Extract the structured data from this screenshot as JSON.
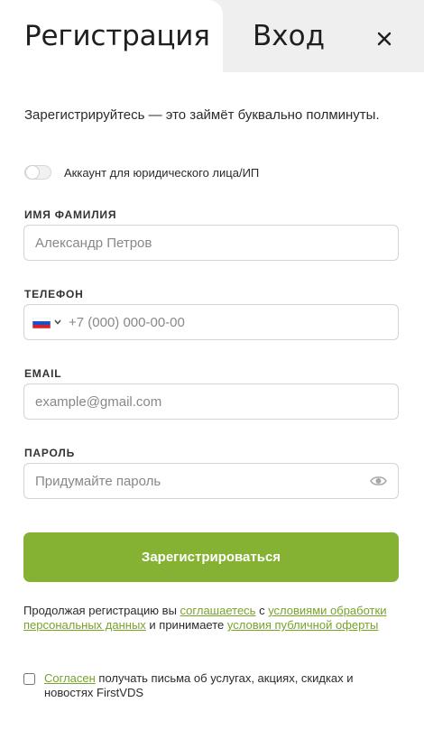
{
  "tabs": {
    "register": "Регистрация",
    "login": "Вход"
  },
  "intro": "Зарегистрируйтесь — это займёт буквально полминуты.",
  "legal_toggle": {
    "label": "Аккаунт для юридического лица/ИП",
    "on": false
  },
  "fields": {
    "name": {
      "label": "ИМЯ ФАМИЛИЯ",
      "placeholder": "Александр Петров",
      "value": ""
    },
    "phone": {
      "label": "ТЕЛЕФОН",
      "placeholder": "+7 (000) 000-00-00",
      "value": "",
      "country": "RU"
    },
    "email": {
      "label": "EMAIL",
      "placeholder": "example@gmail.com",
      "value": ""
    },
    "password": {
      "label": "ПАРОЛЬ",
      "placeholder": "Придумайте пароль",
      "value": ""
    }
  },
  "submit_label": "Зарегистрироваться",
  "terms": {
    "t1": "Продолжая регистрацию вы ",
    "l1": "соглашаетесь",
    "t2": " с ",
    "l2": "условиями обработки персональных данных",
    "t3": " и принимаете ",
    "l3": "условия публичной оферты"
  },
  "consent": {
    "link": "Согласен",
    "text": " получать письма об услугах, акциях, скидках и новостях FirstVDS",
    "checked": false
  },
  "icons": {
    "close": "close-icon",
    "flag": "russia-flag-icon",
    "chevron": "chevron-down-icon",
    "eye": "eye-icon"
  },
  "colors": {
    "accent": "#86b233",
    "link": "#78a32a",
    "tab_bg": "#efefef"
  }
}
